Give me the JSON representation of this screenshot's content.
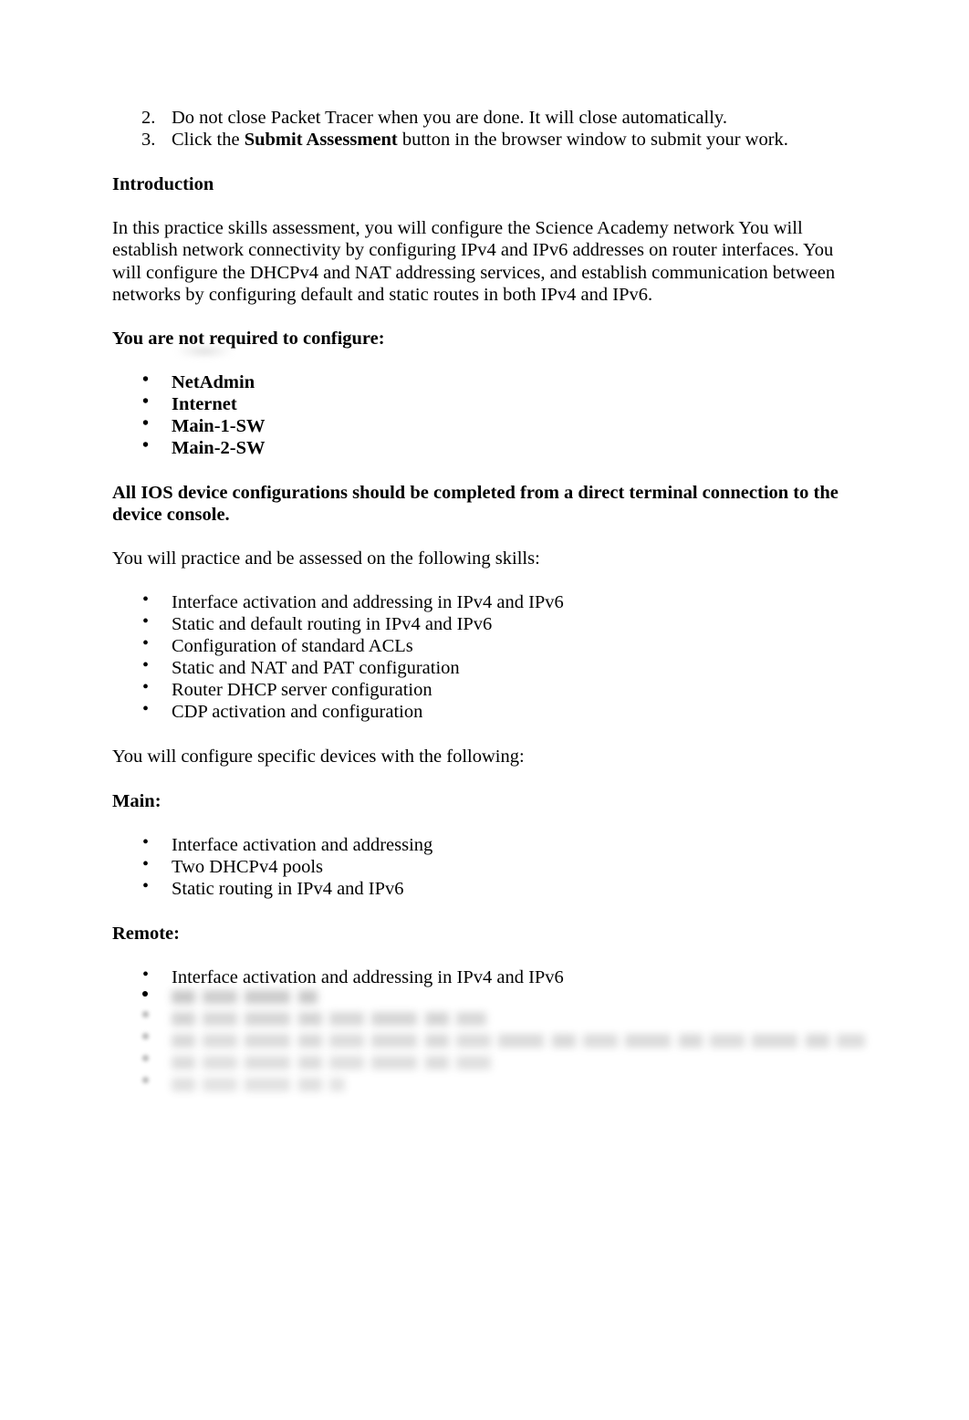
{
  "document": {
    "page_background": "#ffffff",
    "text_color": "#000000",
    "numbered_list": [
      {
        "number": "2.",
        "text_before": "Do not close Packet Tracer when you are done. It will close automatically.",
        "bold": "",
        "text_after": ""
      },
      {
        "number": "3.",
        "text_before": "Click the ",
        "bold": "Submit Assessment",
        "text_after": " button in the browser window to submit your work."
      }
    ],
    "introduction": {
      "heading": "Introduction",
      "paragraph": "In this practice skills assessment, you will configure the Science Academy network You will establish network connectivity by configuring IPv4 and IPv6 addresses on router interfaces. You will configure the DHCPv4 and NAT addressing services, and establish communication between networks by configuring default and static routes in both IPv4 and IPv6."
    },
    "not_required": {
      "heading": "You are not required to configure:",
      "items": [
        "NetAdmin",
        "Internet",
        "Main-1-SW",
        "Main-2-SW"
      ]
    },
    "ios_note": " All IOS device configurations should be completed from a direct terminal connection to the device console.",
    "skills": {
      "lead_in": "You will practice and be assessed on the following skills:",
      "items": [
        "Interface activation and addressing in IPv4 and IPv6",
        "Static and default routing in IPv4 and IPv6",
        "Configuration of standard ACLs",
        "Static and NAT and PAT configuration",
        "Router DHCP server configuration",
        "CDP activation and configuration"
      ]
    },
    "devices": {
      "lead_in": "You will configure specific devices with the following:",
      "main": {
        "heading": "Main:",
        "items": [
          "Interface activation and addressing",
          "Two DHCPv4 pools",
          "Static routing in IPv4 and IPv6"
        ]
      },
      "remote": {
        "heading": "Remote:",
        "items": [
          "Interface activation and addressing in IPv4 and IPv6"
        ],
        "redacted_line_widths": [
          160,
          345,
          760,
          355,
          190
        ]
      }
    },
    "bullet_glyph": "•"
  }
}
